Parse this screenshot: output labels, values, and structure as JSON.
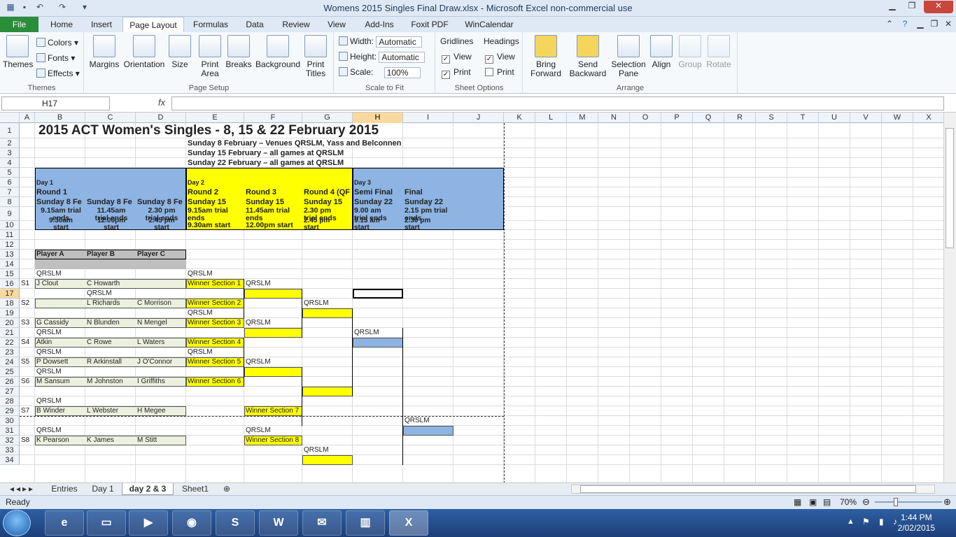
{
  "window": {
    "title": "Womens 2015 Singles Final Draw.xlsx  -  Microsoft Excel non-commercial use"
  },
  "ribbon_tabs": [
    "File",
    "Home",
    "Insert",
    "Page Layout",
    "Formulas",
    "Data",
    "Review",
    "View",
    "Add-Ins",
    "Foxit PDF",
    "WinCalendar"
  ],
  "ribbon": {
    "themes": {
      "themes_label": "Themes",
      "colors": "Colors",
      "fonts": "Fonts",
      "effects": "Effects",
      "group": "Themes"
    },
    "page_setup": {
      "margins": "Margins",
      "orientation": "Orientation",
      "size": "Size",
      "print_area": "Print Area",
      "breaks": "Breaks",
      "background": "Background",
      "print_titles": "Print Titles",
      "group": "Page Setup"
    },
    "scale_to_fit": {
      "width_label": "Width:",
      "width_value": "Automatic",
      "height_label": "Height:",
      "height_value": "Automatic",
      "scale_label": "Scale:",
      "scale_value": "100%",
      "group": "Scale to Fit"
    },
    "sheet_options": {
      "gridlines": "Gridlines",
      "headings": "Headings",
      "view": "View",
      "print": "Print",
      "group": "Sheet Options",
      "gridlines_view_checked": true,
      "gridlines_print_checked": true,
      "headings_view_checked": true,
      "headings_print_checked": false
    },
    "arrange": {
      "bring_forward": "Bring Forward",
      "send_backward": "Send Backward",
      "selection_pane": "Selection Pane",
      "align": "Align",
      "group_btn": "Group",
      "rotate": "Rotate",
      "group": "Arrange"
    }
  },
  "formula_bar": {
    "name_box": "H17",
    "fx": "fx",
    "value": ""
  },
  "columns": [
    "A",
    "B",
    "C",
    "D",
    "E",
    "F",
    "G",
    "H",
    "I",
    "J",
    "K",
    "L",
    "M",
    "N",
    "O",
    "P",
    "Q",
    "R",
    "S",
    "T",
    "U",
    "V",
    "W",
    "X"
  ],
  "rows": [
    "1",
    "2",
    "3",
    "4",
    "5",
    "6",
    "7",
    "8",
    "9",
    "10",
    "11",
    "12",
    "13",
    "14",
    "15",
    "16",
    "17",
    "18",
    "19",
    "20",
    "21",
    "22",
    "23",
    "24",
    "25",
    "26",
    "27",
    "28",
    "29",
    "30",
    "31",
    "32",
    "33",
    "34"
  ],
  "sheet": {
    "title": "2015 ACT Women's Singles  - 8, 15 & 22 February 2015",
    "venue1": "Sunday 8 February – Venues  QRSLM, Yass and Belconnen",
    "venue2": "Sunday 15 February – all games at QRSLM",
    "venue3": "Sunday 22 February – all games at QRSLM",
    "day1": "Day 1",
    "day2": "Day 2",
    "day3": "Day 3",
    "round1": "Round 1",
    "round2": "Round 2",
    "round3": "Round 3",
    "round4": "Round 4 (QF",
    "semi": "Semi Final",
    "final": "Final",
    "b8": "Sunday 8 Fe",
    "c8": "Sunday 8 Fe",
    "d8": "Sunday 8 Fe",
    "e8": "Sunday 15",
    "f8": "Sunday 15",
    "g8": "Sunday 15",
    "h8": "Sunday 22",
    "i8": "Sunday 22",
    "b9a": "9.15am trial",
    "b9b": "ends",
    "c9a": "11.45am",
    "c9b": "trial ends",
    "d9a": "2.30 pm",
    "d9b": "trial ends",
    "e9a": "9.15am trial",
    "e9b": "ends",
    "f9a": "11.45am trial",
    "f9b": "ends",
    "g9a": "2.30 pm",
    "g9b": "trial ends",
    "h9a": "9.00 am",
    "h9b": "trial ends",
    "i9a": "2.15 pm trial",
    "i9b": "ends",
    "b10a": "9.30am",
    "b10b": "start",
    "c10a": "12.00pm",
    "c10b": "start",
    "d10a": "2.45 pm",
    "d10b": "start",
    "e10": "9.30am start",
    "f10": "12.00pm start",
    "g10a": "2.45 pm",
    "g10b": "start",
    "h10a": "9.15 am",
    "h10b": "start",
    "i10a": "2.30 pm",
    "i10b": "start",
    "player_a": "Player A",
    "player_b": "Player B",
    "player_c": "Player C",
    "qrslm": "QRSLM",
    "cells": [
      {
        "r": 15,
        "c": "B",
        "t": "QRSLM"
      },
      {
        "r": 15,
        "c": "E",
        "t": "QRSLM"
      },
      {
        "r": 16,
        "c": "A",
        "t": "S1"
      },
      {
        "r": 16,
        "c": "B",
        "t": "J Clout"
      },
      {
        "r": 16,
        "c": "C",
        "t": "C Howarth"
      },
      {
        "r": 16,
        "c": "E",
        "t": "Winner Section 1"
      },
      {
        "r": 16,
        "c": "F",
        "t": "QRSLM"
      },
      {
        "r": 17,
        "c": "C",
        "t": "QRSLM"
      },
      {
        "r": 18,
        "c": "A",
        "t": "S2"
      },
      {
        "r": 18,
        "c": "C",
        "t": "L Richards"
      },
      {
        "r": 18,
        "c": "D",
        "t": "C Morrison"
      },
      {
        "r": 18,
        "c": "E",
        "t": "Winner Section 2"
      },
      {
        "r": 18,
        "c": "G",
        "t": "QRSLM"
      },
      {
        "r": 19,
        "c": "E",
        "t": "QRSLM"
      },
      {
        "r": 20,
        "c": "A",
        "t": "S3"
      },
      {
        "r": 20,
        "c": "B",
        "t": "G Cassidy"
      },
      {
        "r": 20,
        "c": "C",
        "t": "N Blunden"
      },
      {
        "r": 20,
        "c": "D",
        "t": "N Mengel"
      },
      {
        "r": 20,
        "c": "E",
        "t": "Winner Section 3"
      },
      {
        "r": 20,
        "c": "F",
        "t": "QRSLM"
      },
      {
        "r": 21,
        "c": "B",
        "t": "QRSLM"
      },
      {
        "r": 21,
        "c": "H",
        "t": "QRSLM"
      },
      {
        "r": 22,
        "c": "A",
        "t": "S4"
      },
      {
        "r": 22,
        "c": "B",
        "t": "Atkin"
      },
      {
        "r": 22,
        "c": "C",
        "t": "C Rowe"
      },
      {
        "r": 22,
        "c": "D",
        "t": "L Waters"
      },
      {
        "r": 22,
        "c": "E",
        "t": "Winner Section 4"
      },
      {
        "r": 23,
        "c": "B",
        "t": "QRSLM"
      },
      {
        "r": 23,
        "c": "E",
        "t": "QRSLM"
      },
      {
        "r": 24,
        "c": "A",
        "t": "S5"
      },
      {
        "r": 24,
        "c": "B",
        "t": "P Dowsett"
      },
      {
        "r": 24,
        "c": "C",
        "t": "R Arkinstall"
      },
      {
        "r": 24,
        "c": "D",
        "t": "J O'Connor"
      },
      {
        "r": 24,
        "c": "E",
        "t": "Winner Section 5"
      },
      {
        "r": 24,
        "c": "F",
        "t": "QRSLM"
      },
      {
        "r": 25,
        "c": "B",
        "t": "QRSLM"
      },
      {
        "r": 26,
        "c": "A",
        "t": "S6"
      },
      {
        "r": 26,
        "c": "B",
        "t": "M Sansum"
      },
      {
        "r": 26,
        "c": "C",
        "t": "M Johnston"
      },
      {
        "r": 26,
        "c": "D",
        "t": "I Griffiths"
      },
      {
        "r": 26,
        "c": "E",
        "t": "Winner Section 6"
      },
      {
        "r": 28,
        "c": "B",
        "t": "QRSLM"
      },
      {
        "r": 29,
        "c": "A",
        "t": "S7"
      },
      {
        "r": 29,
        "c": "B",
        "t": "B Winder"
      },
      {
        "r": 29,
        "c": "C",
        "t": "L Webster"
      },
      {
        "r": 29,
        "c": "D",
        "t": "H Megee"
      },
      {
        "r": 29,
        "c": "F",
        "t": "Winner Section 7"
      },
      {
        "r": 30,
        "c": "I",
        "t": "QRSLM"
      },
      {
        "r": 31,
        "c": "B",
        "t": "QRSLM"
      },
      {
        "r": 31,
        "c": "F",
        "t": "QRSLM"
      },
      {
        "r": 32,
        "c": "A",
        "t": "S8"
      },
      {
        "r": 32,
        "c": "B",
        "t": "K Pearson"
      },
      {
        "r": 32,
        "c": "C",
        "t": "K James"
      },
      {
        "r": 32,
        "c": "D",
        "t": "M Stitt"
      },
      {
        "r": 32,
        "c": "F",
        "t": "Winner Section 8"
      },
      {
        "r": 33,
        "c": "G",
        "t": "QRSLM"
      }
    ]
  },
  "sheet_tabs": [
    "Entries",
    "Day 1",
    "day 2 & 3",
    "Sheet1"
  ],
  "active_sheet": "day 2 & 3",
  "status": {
    "ready": "Ready",
    "zoom": "70%"
  },
  "taskbar": {
    "time": "1:44 PM",
    "date": "2/02/2015"
  },
  "colors": {
    "yellow": "#ffff00",
    "blue": "#8db4e2",
    "grey": "#bfbfbf",
    "green_tint": "#ebf1de",
    "file_tab": "#2a8d3a"
  }
}
